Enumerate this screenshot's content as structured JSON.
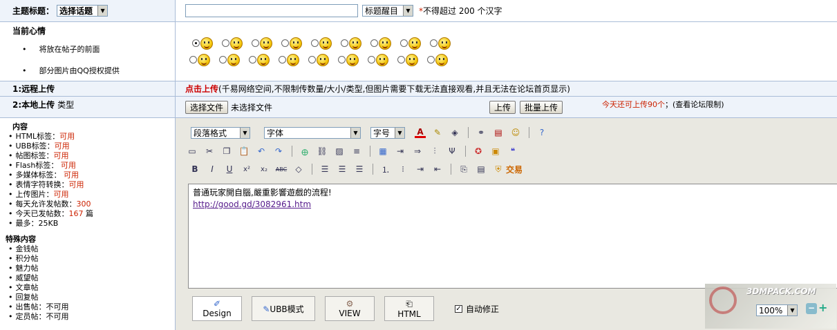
{
  "subject": {
    "label": "主题标题：",
    "topic_select": "选择话题",
    "highlight_select": "标题醒目",
    "star": "*",
    "hint": "不得超过 200 个汉字",
    "title_value": ""
  },
  "mood": {
    "label": "当前心情",
    "notes": [
      "将放在帖子的前面",
      "部分图片由QQ授权提供"
    ],
    "selected_index": 0,
    "faces_row1": [
      "smile-face",
      "drool-face",
      "grin-face",
      "heart-eyes-face",
      "wink-face",
      "turtle-face",
      "blush-face",
      "sweat-face",
      "surprised-face"
    ],
    "faces_row2": [
      "laugh-face",
      "cry-face",
      "scared-face",
      "shy-face",
      "bulge-face",
      "sunglasses-face",
      "sad-face",
      "sleepy-face",
      "angry-face"
    ]
  },
  "remote_upload": {
    "label": "1:远程上传",
    "link": "点击上传",
    "desc": "(千易网络空间,不限制传数量/大小/类型,但图片需要下载无法直接观看,并且无法在论坛首页显示)"
  },
  "local_upload": {
    "label": "2:本地上传",
    "type_label": "类型",
    "choose_file": "选择文件",
    "no_file": "未选择文件",
    "upload": "上传",
    "batch_upload": "批量上传",
    "quota": "今天还可上传90个",
    "limit": "；(查看论坛限制)"
  },
  "content_info": {
    "heading": "内容",
    "items": [
      {
        "label": "HTML标签：",
        "value": "可用"
      },
      {
        "label": "UBB标签：",
        "value": "可用"
      },
      {
        "label": "帖图标签：",
        "value": "可用"
      },
      {
        "label": "Flash标签： ",
        "value": "可用"
      },
      {
        "label": "多媒体标签： ",
        "value": "可用"
      },
      {
        "label": "表情字符转换：",
        "value": "可用"
      },
      {
        "label": "上传图片：",
        "value": "可用"
      },
      {
        "label": "每天允许发帖数：",
        "value": "300"
      },
      {
        "label": "今天已发帖数：",
        "value": "167",
        "suffix": " 篇"
      },
      {
        "label": "最多：25KB",
        "value": ""
      }
    ],
    "special_heading": "特殊内容",
    "special_items": [
      "金钱帖",
      "积分帖",
      "魅力帖",
      "威望帖",
      "文章帖",
      "回复帖",
      "出售帖：不可用",
      "定员帖：不可用"
    ]
  },
  "editor": {
    "paragraph_select": "段落格式",
    "font_select": "字体",
    "size_select": "字号",
    "trade_label": "交易",
    "body_line1": "普通玩家開自腦,嚴重影響遊戲的流程!",
    "body_link": "http://good.gd/3082961.htm",
    "modes": [
      "Design",
      "UBB模式",
      "VIEW",
      "HTML"
    ],
    "auto_fix": "自动修正",
    "zoom": "100%",
    "watermark": "3DMPACK.COM"
  }
}
